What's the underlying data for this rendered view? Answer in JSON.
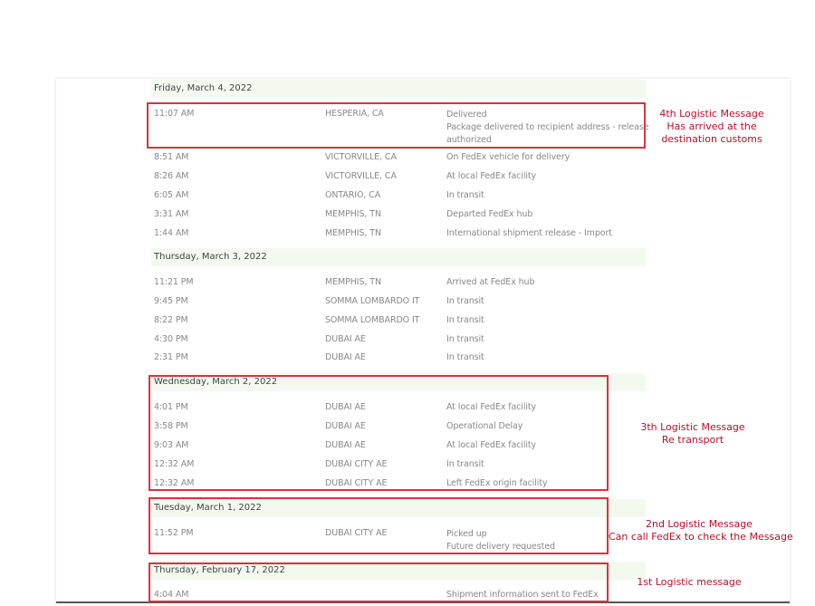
{
  "groups": [
    {
      "date": "Friday, March 4, 2022",
      "events": [
        {
          "time": "11:07 AM",
          "location": "HESPERIA, CA",
          "status": [
            "Delivered",
            "Package delivered to recipient address - release",
            "authorized"
          ]
        },
        {
          "time": "8:51 AM",
          "location": "VICTORVILLE, CA",
          "status": [
            "On FedEx vehicle for delivery"
          ]
        },
        {
          "time": "8:26 AM",
          "location": "VICTORVILLE, CA",
          "status": [
            "At local FedEx facility"
          ]
        },
        {
          "time": "6:05 AM",
          "location": "ONTARIO, CA",
          "status": [
            "In transit"
          ]
        },
        {
          "time": "3:31 AM",
          "location": "MEMPHIS, TN",
          "status": [
            "Departed FedEx hub"
          ]
        },
        {
          "time": "1:44 AM",
          "location": "MEMPHIS, TN",
          "status": [
            "International shipment release - Import"
          ]
        }
      ]
    },
    {
      "date": "Thursday, March 3, 2022",
      "events": [
        {
          "time": "11:21 PM",
          "location": "MEMPHIS, TN",
          "status": [
            "Arrived at FedEx hub"
          ]
        },
        {
          "time": "9:45 PM",
          "location": "SOMMA LOMBARDO IT",
          "status": [
            "In transit"
          ]
        },
        {
          "time": "8:22 PM",
          "location": "SOMMA LOMBARDO IT",
          "status": [
            "In transit"
          ]
        },
        {
          "time": "4:30 PM",
          "location": "DUBAI AE",
          "status": [
            "In transit"
          ]
        },
        {
          "time": "2:31 PM",
          "location": "DUBAI AE",
          "status": [
            "In transit"
          ]
        }
      ]
    },
    {
      "date": "Wednesday, March 2, 2022",
      "events": [
        {
          "time": "4:01 PM",
          "location": "DUBAI AE",
          "status": [
            "At local FedEx facility"
          ]
        },
        {
          "time": "3:58 PM",
          "location": "DUBAI AE",
          "status": [
            "Operational Delay"
          ]
        },
        {
          "time": "9:03 AM",
          "location": "DUBAI AE",
          "status": [
            "At local FedEx facility"
          ]
        },
        {
          "time": "12:32 AM",
          "location": "DUBAI CITY AE",
          "status": [
            "In transit"
          ]
        },
        {
          "time": "12:32 AM",
          "location": "DUBAI CITY AE",
          "status": [
            "Left FedEx origin facility"
          ]
        }
      ]
    },
    {
      "date": "Tuesday, March 1, 2022",
      "events": [
        {
          "time": "11:52 PM",
          "location": "DUBAI CITY AE",
          "status": [
            "Picked up",
            "Future delivery requested"
          ]
        }
      ]
    },
    {
      "date": "Thursday, February 17, 2022",
      "events": [
        {
          "time": "4:04 AM",
          "location": "",
          "status": [
            "Shipment information sent to FedEx"
          ]
        }
      ]
    }
  ],
  "annotations": [
    {
      "lines": [
        "4th Logistic Message",
        "Has arrived at the",
        "destination customs"
      ]
    },
    {
      "lines": [
        "3th Logistic Message",
        "Re transport"
      ]
    },
    {
      "lines": [
        "2nd Logistic Message",
        "Can call FedEx to check the Message"
      ]
    },
    {
      "lines": [
        "1st Logistic message"
      ]
    }
  ],
  "colors": {
    "highlight_box": "#d9333f",
    "annotation_text": "#b5102a",
    "date_band": "#f3f9ef"
  }
}
